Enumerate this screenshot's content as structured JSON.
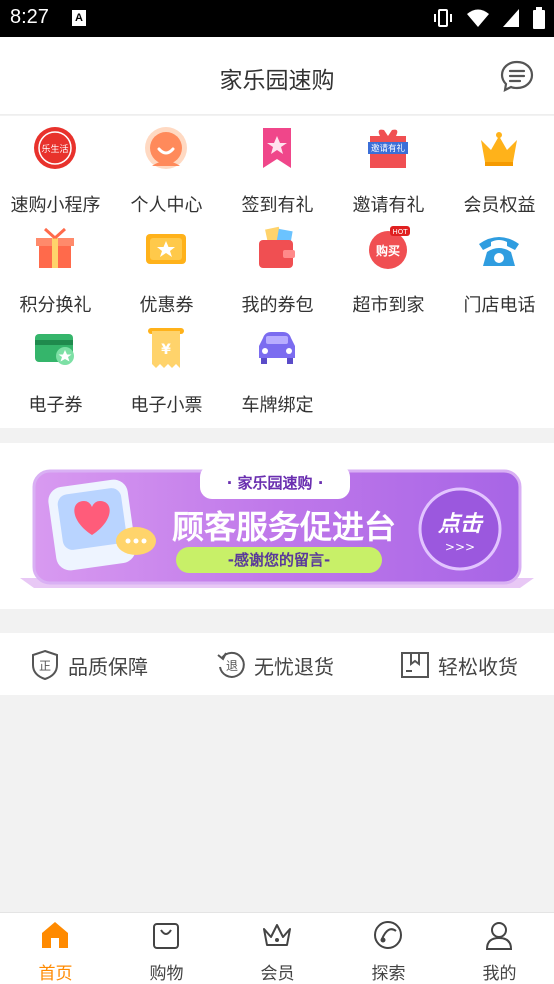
{
  "status_bar": {
    "time": "8:27",
    "a_badge": "A"
  },
  "header": {
    "title": "家乐园速购",
    "message_icon": "message-icon"
  },
  "grid_items": [
    {
      "label": "速购小程序",
      "icon": "mini-program-icon",
      "mini_text": "乐生活"
    },
    {
      "label": "个人中心",
      "icon": "profile-icon"
    },
    {
      "label": "签到有礼",
      "icon": "sign-in-icon"
    },
    {
      "label": "邀请有礼",
      "icon": "invite-gift-icon",
      "mini_text": "邀请有礼"
    },
    {
      "label": "会员权益",
      "icon": "crown-icon"
    },
    {
      "label": "积分换礼",
      "icon": "points-gift-icon"
    },
    {
      "label": "优惠券",
      "icon": "coupon-icon"
    },
    {
      "label": "我的券包",
      "icon": "wallet-icon"
    },
    {
      "label": "超市到家",
      "icon": "shopping-hot-icon",
      "mini_text": "购买",
      "hot_text": "HOT"
    },
    {
      "label": "门店电话",
      "icon": "phone-icon"
    },
    {
      "label": "电子券",
      "icon": "e-coupon-icon"
    },
    {
      "label": "电子小票",
      "icon": "receipt-icon",
      "mini_text": "¥"
    },
    {
      "label": "车牌绑定",
      "icon": "car-icon"
    }
  ],
  "banner": {
    "top_tag": "· 家乐园速购 ·",
    "headline": "顾客服务促进台",
    "subline": "-感谢您的留言-",
    "cta": "点击",
    "cta_arrows": ">>>"
  },
  "guarantees": [
    {
      "label": "品质保障",
      "icon": "quality-badge-icon",
      "glyph": "正"
    },
    {
      "label": "无忧退货",
      "icon": "return-icon",
      "glyph": "退"
    },
    {
      "label": "轻松收货",
      "icon": "delivery-box-icon"
    }
  ],
  "tabs": [
    {
      "label": "首页",
      "icon": "home-icon",
      "active": true
    },
    {
      "label": "购物",
      "icon": "shopping-bag-icon",
      "active": false
    },
    {
      "label": "会员",
      "icon": "member-crown-icon",
      "active": false
    },
    {
      "label": "探索",
      "icon": "explore-icon",
      "active": false
    },
    {
      "label": "我的",
      "icon": "user-icon",
      "active": false
    }
  ],
  "colors": {
    "accent": "#ff8a00",
    "banner_purple": "#b46ee8",
    "banner_green": "#c8f068"
  }
}
